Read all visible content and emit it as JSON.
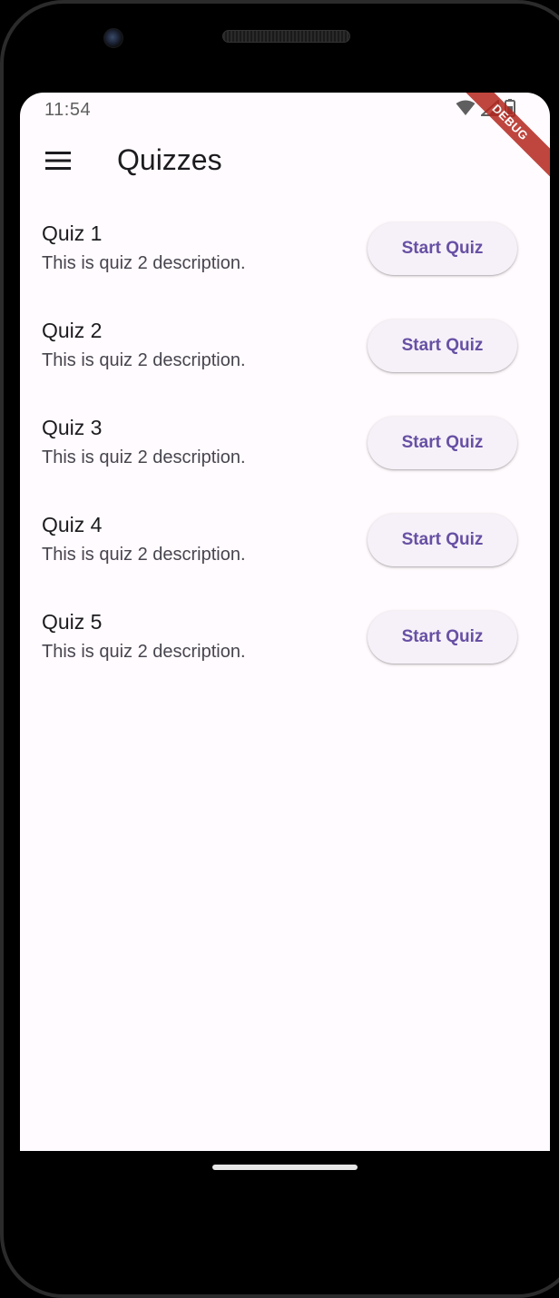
{
  "status_bar": {
    "time": "11:54",
    "icons": [
      "wifi-icon",
      "cellular-signal-icon",
      "battery-icon"
    ]
  },
  "debug_banner": "DEBUG",
  "app_bar": {
    "menu_icon": "menu-icon",
    "title": "Quizzes"
  },
  "quizzes": [
    {
      "title": "Quiz 1",
      "description": "This is quiz 2 description.",
      "button_label": "Start Quiz"
    },
    {
      "title": "Quiz 2",
      "description": "This is quiz 2 description.",
      "button_label": "Start Quiz"
    },
    {
      "title": "Quiz 3",
      "description": "This is quiz 2 description.",
      "button_label": "Start Quiz"
    },
    {
      "title": "Quiz 4",
      "description": "This is quiz 2 description.",
      "button_label": "Start Quiz"
    },
    {
      "title": "Quiz 5",
      "description": "This is quiz 2 description.",
      "button_label": "Start Quiz"
    }
  ],
  "colors": {
    "background": "#fffbfe",
    "primary": "#6750a4",
    "button_surface": "#f6f1f8",
    "text_primary": "#1c1b1f",
    "text_secondary": "#49454f",
    "debug_banner": "#b3261e"
  }
}
